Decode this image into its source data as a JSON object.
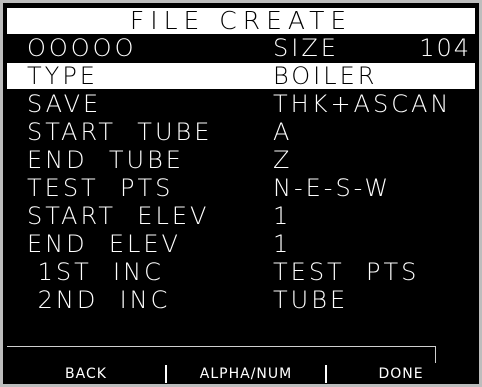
{
  "title": "FILE CREATE",
  "header_row": {
    "name": "OOOOO",
    "size_label": "SIZE",
    "size_value": "104"
  },
  "rows": [
    {
      "label": "TYPE",
      "value": "BOILER",
      "selected": true
    },
    {
      "label": "SAVE",
      "value": "THK+ASCAN"
    },
    {
      "label": "START  TUBE",
      "value": "A"
    },
    {
      "label": "END  TUBE",
      "value": "Z"
    },
    {
      "label": "TEST  PTS",
      "value": "N-E-S-W"
    },
    {
      "label": "START  ELEV",
      "value": "1"
    },
    {
      "label": "END  ELEV",
      "value": "1"
    },
    {
      "label": " 1ST  INC",
      "value": "TEST  PTS"
    },
    {
      "label": " 2ND  INC",
      "value": "TUBE"
    }
  ],
  "softkeys": {
    "back": "BACK",
    "alpha_num": "ALPHA/NUM",
    "done": "DONE"
  }
}
